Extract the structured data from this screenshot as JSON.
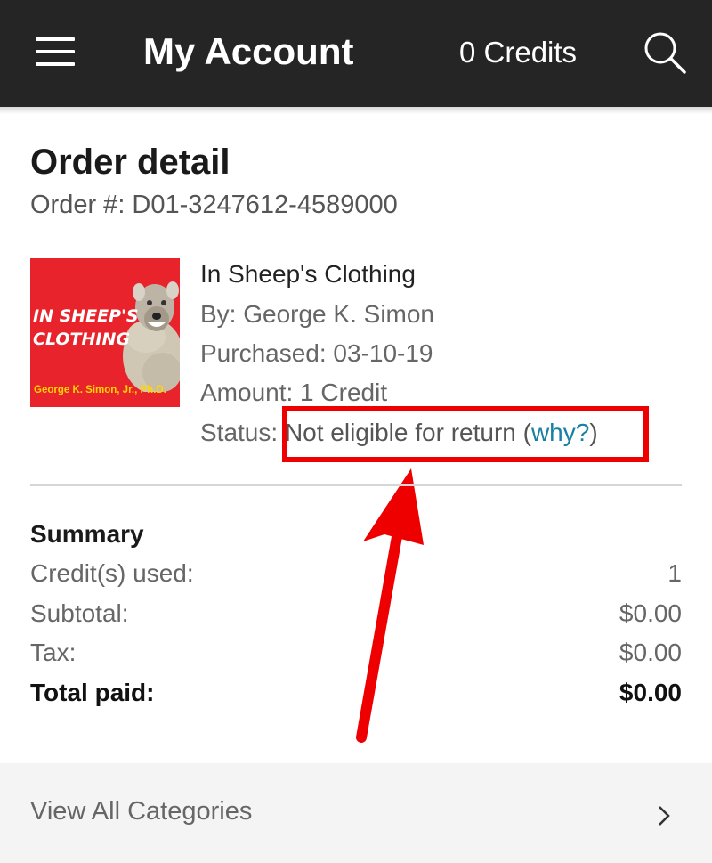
{
  "header": {
    "title": "My Account",
    "credits": "0 Credits",
    "menu_icon": "hamburger-menu-icon",
    "search_icon": "search-icon",
    "background": "#252525"
  },
  "page": {
    "heading": "Order detail",
    "order_number": "Order #: D01-3247612-4589000"
  },
  "item": {
    "cover": {
      "title_line1": "IN SHEEP'S",
      "title_line2": "CLOTHING",
      "author": "George K. Simon, Jr., Ph.D."
    },
    "title": "In Sheep's Clothing",
    "author": "By: George K. Simon",
    "purchased": "Purchased: 03-10-19",
    "amount": "Amount: 1 Credit",
    "status_label": "Status: ",
    "status_value": "Not eligible for return (",
    "status_link": "why?",
    "status_close": ")"
  },
  "summary": {
    "heading": "Summary",
    "rows": [
      {
        "label": "Credit(s) used:",
        "value": "1"
      },
      {
        "label": "Subtotal:",
        "value": "$0.00"
      },
      {
        "label": "Tax:",
        "value": "$0.00"
      },
      {
        "label": "Total paid:",
        "value": "$0.00"
      }
    ]
  },
  "footer": {
    "label": "View All Categories",
    "icon": "chevron-right-icon"
  },
  "colors": {
    "annotation": "#ee0000",
    "link": "#1a7fa6"
  }
}
